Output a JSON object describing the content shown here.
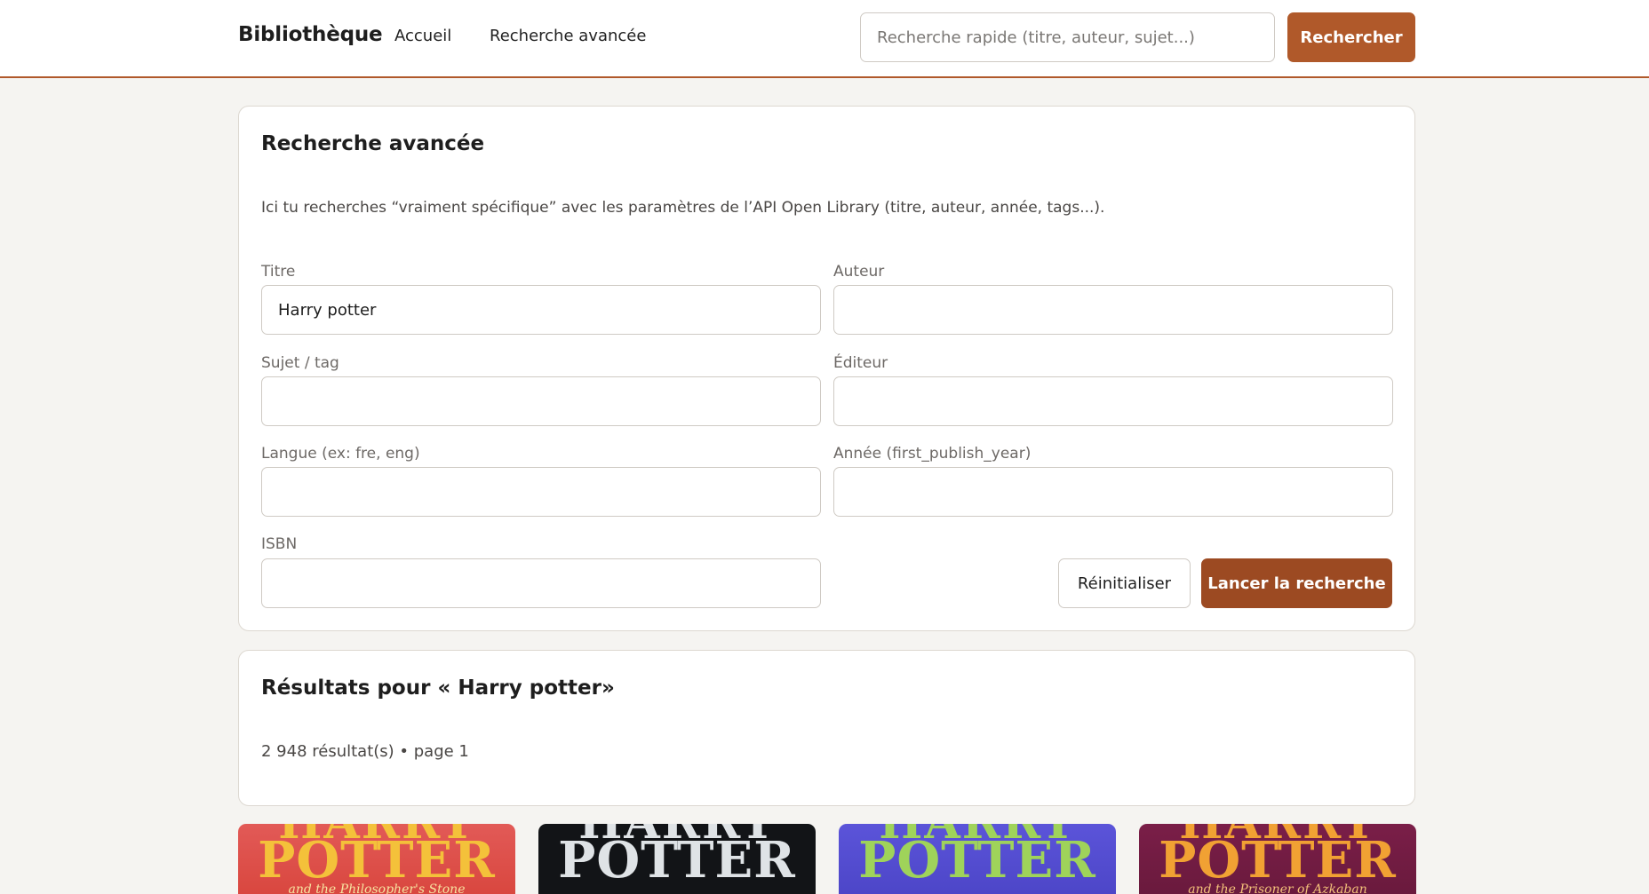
{
  "header": {
    "brand": "Bibliothèque",
    "nav": {
      "home": "Accueil",
      "advanced": "Recherche avancée"
    },
    "quick_search": {
      "placeholder": "Recherche rapide (titre, auteur, sujet...)",
      "value": ""
    },
    "search_button": "Rechercher"
  },
  "form": {
    "title": "Recherche avancée",
    "description": "Ici tu recherches “vraiment spécifique” avec les paramètres de l’API Open Library (titre, auteur, année, tags...).",
    "fields": {
      "title": {
        "label": "Titre",
        "value": "Harry potter"
      },
      "author": {
        "label": "Auteur",
        "value": ""
      },
      "subject": {
        "label": "Sujet / tag",
        "value": ""
      },
      "publisher": {
        "label": "Éditeur",
        "value": ""
      },
      "language": {
        "label": "Langue (ex: fre, eng)",
        "value": ""
      },
      "year": {
        "label": "Année (first_publish_year)",
        "value": ""
      },
      "isbn": {
        "label": "ISBN",
        "value": ""
      }
    },
    "reset_button": "Réinitialiser",
    "submit_button": "Lancer la recherche"
  },
  "results": {
    "title": "Résultats pour « Harry potter»",
    "summary": "2 948 résultat(s) • page 1"
  },
  "covers": [
    {
      "top": "HARRY",
      "main": "POTTER",
      "sub": "and the Philosopher's Stone"
    },
    {
      "top": "HARRY",
      "main": "POTTER",
      "sub": ""
    },
    {
      "top": "HARRY",
      "main": "POTTER",
      "sub": ""
    },
    {
      "top": "HARRY",
      "main": "POTTER",
      "sub": "and the Prisoner of Azkaban"
    }
  ],
  "colors": {
    "accent": "#b0592a",
    "accent_dark": "#9c4a22",
    "background": "#f5f4f1"
  }
}
